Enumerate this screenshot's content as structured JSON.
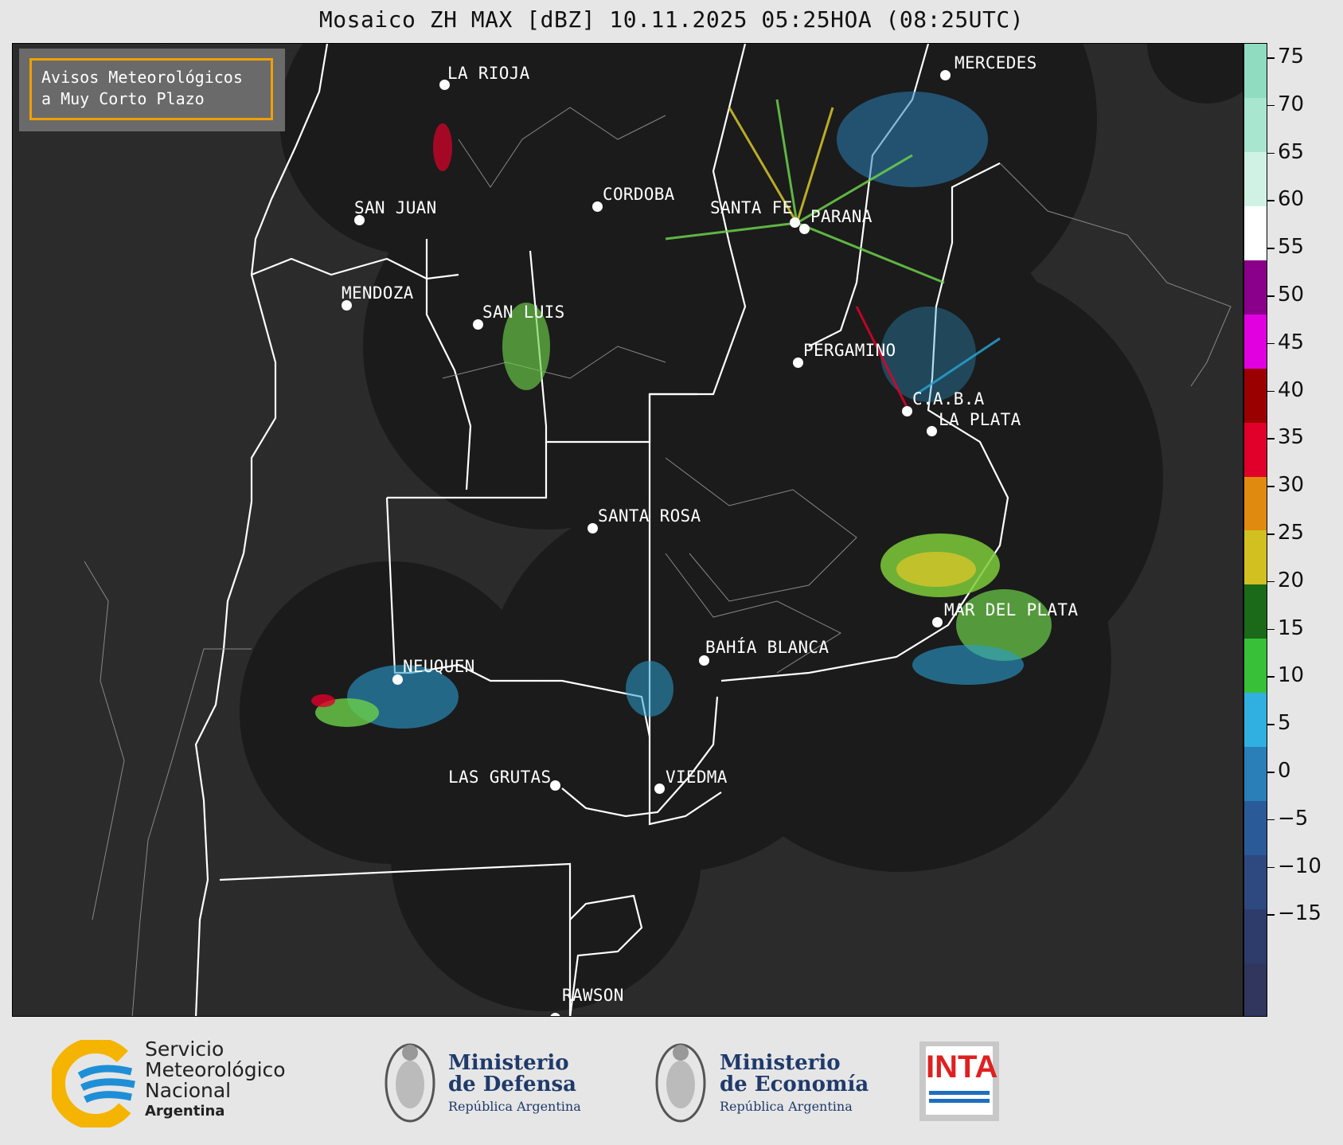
{
  "title": "Mosaico ZH MAX [dBZ] 10.11.2025 05:25HOA (08:25UTC)",
  "warning_box": {
    "line1": "Avisos Meteorológicos",
    "line2": "a Muy Corto Plazo",
    "border_color": "#f0a000"
  },
  "cities": [
    {
      "name": "LA RIOJA"
    },
    {
      "name": "SAN JUAN"
    },
    {
      "name": "CORDOBA"
    },
    {
      "name": "MENDOZA"
    },
    {
      "name": "SAN LUIS"
    },
    {
      "name": "SANTA FE"
    },
    {
      "name": "PARANA"
    },
    {
      "name": "MERCEDES"
    },
    {
      "name": "PERGAMINO"
    },
    {
      "name": "C.A.B.A"
    },
    {
      "name": "LA PLATA"
    },
    {
      "name": "SANTA ROSA"
    },
    {
      "name": "MAR DEL PLATA"
    },
    {
      "name": "BAHÍA BLANCA"
    },
    {
      "name": "NEUQUEN"
    },
    {
      "name": "LAS GRUTAS"
    },
    {
      "name": "VIEDMA"
    },
    {
      "name": "RAWSON"
    }
  ],
  "colorbar": {
    "unit": "dBZ",
    "ticks": [
      "75",
      "70",
      "65",
      "60",
      "55",
      "50",
      "45",
      "40",
      "35",
      "30",
      "25",
      "20",
      "15",
      "10",
      "5",
      "0",
      "−5",
      "−10",
      "−15"
    ],
    "stops": [
      {
        "color": "#8fdcc0"
      },
      {
        "color": "#a8e6cf"
      },
      {
        "color": "#d0f2e4"
      },
      {
        "color": "#ffffff"
      },
      {
        "color": "#8b008b"
      },
      {
        "color": "#e000e0"
      },
      {
        "color": "#9b0000"
      },
      {
        "color": "#e0002a"
      },
      {
        "color": "#e08a10"
      },
      {
        "color": "#d2c020"
      },
      {
        "color": "#1a6a1a"
      },
      {
        "color": "#38c038"
      },
      {
        "color": "#30b0e0"
      },
      {
        "color": "#2a7fb8"
      },
      {
        "color": "#2a5a98"
      },
      {
        "color": "#2e4880"
      },
      {
        "color": "#2e3c6c"
      },
      {
        "color": "#30365e"
      }
    ]
  },
  "logos": {
    "smn": {
      "line1": "Servicio",
      "line2": "Meteorológico",
      "line3": "Nacional",
      "line4": "Argentina"
    },
    "defensa": {
      "line1": "Ministerio",
      "line2": "de Defensa",
      "line3": "República Argentina"
    },
    "economia": {
      "line1": "Ministerio",
      "line2": "de Economía",
      "line3": "República Argentina"
    },
    "inta": {
      "text": "INTA"
    }
  }
}
